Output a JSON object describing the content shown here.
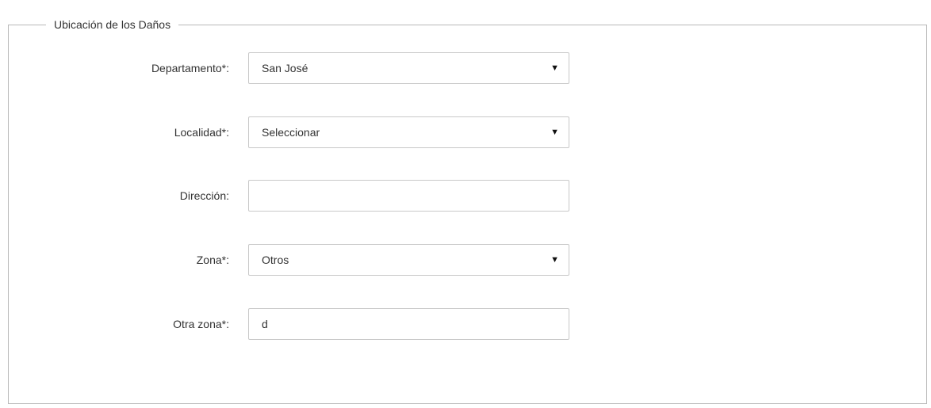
{
  "fieldset": {
    "legend": "Ubicación de los Daños"
  },
  "fields": [
    {
      "label": "Departamento*:",
      "type": "select",
      "value": "San José"
    },
    {
      "label": "Localidad*:",
      "type": "select",
      "value": "Seleccionar"
    },
    {
      "label": "Dirección:",
      "type": "text",
      "value": ""
    },
    {
      "label": "Zona*:",
      "type": "select",
      "value": "Otros"
    },
    {
      "label": "Otra zona*:",
      "type": "text",
      "value": "d"
    }
  ],
  "icons": {
    "dropdown": "triangle-down-icon"
  },
  "colors": {
    "border": "#c8c8c8",
    "fieldset_border": "#b9b9b9",
    "text": "#333333"
  }
}
